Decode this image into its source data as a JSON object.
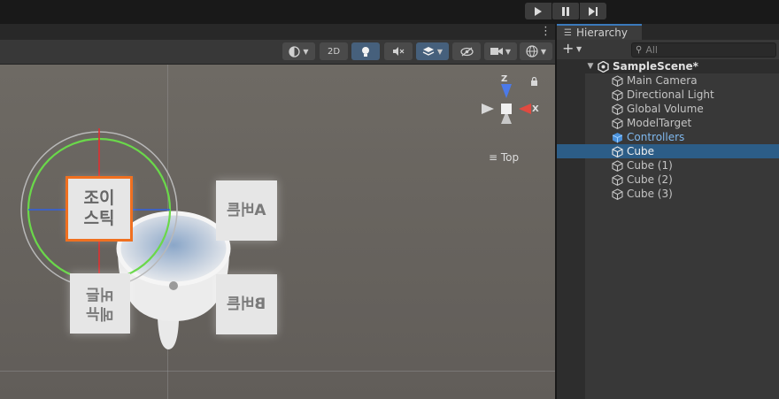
{
  "playbar": {
    "play_icon": "play-icon",
    "pause_icon": "pause-icon",
    "step_icon": "step-icon"
  },
  "scene": {
    "toolbar": {
      "mode_2d": "2D"
    },
    "gizmo": {
      "y_label": "Z",
      "x_label": "X",
      "view_label": "Top"
    },
    "cards": {
      "joystick": "조이\n스틱",
      "button_a": "A버튼",
      "button_b": "B버튼",
      "menu_button": "메뉴\n버튼"
    }
  },
  "hierarchy": {
    "tab_label": "Hierarchy",
    "search_placeholder": "All",
    "scene_name": "SampleScene*",
    "items": [
      {
        "label": "Main Camera"
      },
      {
        "label": "Directional Light"
      },
      {
        "label": "Global Volume"
      },
      {
        "label": "ModelTarget"
      },
      {
        "label": "Controllers"
      },
      {
        "label": "Cube"
      },
      {
        "label": "Cube (1)"
      },
      {
        "label": "Cube (2)"
      },
      {
        "label": "Cube (3)"
      }
    ]
  },
  "colors": {
    "selection": "#2c5d87",
    "accent_blue": "#3a79bb",
    "orange_outline": "#f07020"
  }
}
